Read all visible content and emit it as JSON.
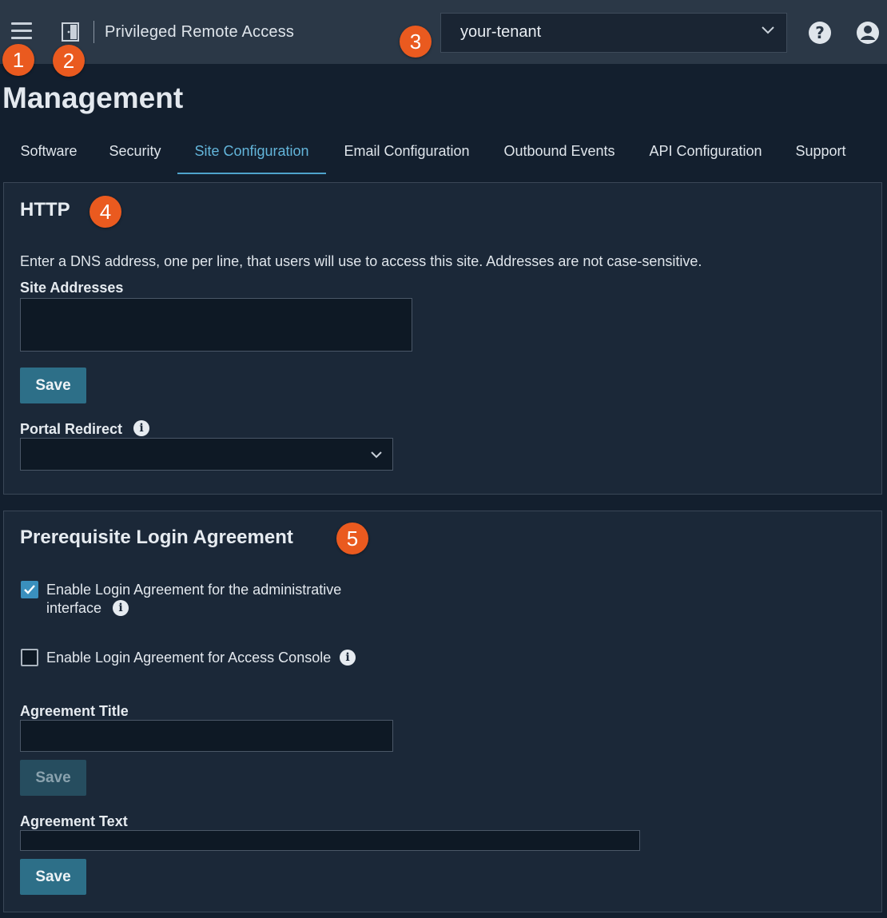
{
  "header": {
    "app_title": "Privileged Remote Access",
    "tenant": "your-tenant",
    "icons": [
      "menu-icon",
      "door-icon",
      "chevron-down-icon",
      "help-icon",
      "user-icon"
    ]
  },
  "callouts": [
    "1",
    "2",
    "3",
    "4",
    "5"
  ],
  "page_title": "Management",
  "tabs": [
    {
      "label": "Software"
    },
    {
      "label": "Security"
    },
    {
      "label": "Site Configuration",
      "active": true
    },
    {
      "label": "Email Configuration"
    },
    {
      "label": "Outbound Events"
    },
    {
      "label": "API Configuration"
    },
    {
      "label": "Support"
    }
  ],
  "http": {
    "title": "HTTP",
    "description": "Enter a DNS address, one per line, that users will use to access this site. Addresses are not case-sensitive.",
    "site_addresses_label": "Site Addresses",
    "site_addresses_value": "",
    "save_label": "Save",
    "portal_redirect_label": "Portal Redirect",
    "portal_redirect_value": ""
  },
  "agreement": {
    "title": "Prerequisite Login Agreement",
    "enable_admin_label_line1": "Enable Login Agreement for the administrative",
    "enable_admin_label_line2": "interface",
    "enable_admin_checked": true,
    "enable_console_label": "Enable Login Agreement for Access Console",
    "enable_console_checked": false,
    "agreement_title_label": "Agreement Title",
    "agreement_title_value": "",
    "save_title_label": "Save",
    "agreement_text_label": "Agreement Text",
    "agreement_text_value": "",
    "save_text_label": "Save"
  },
  "colors": {
    "topbar": "#2b3847",
    "background": "#131f2e",
    "panel": "#1b2838",
    "accent": "#63b5da",
    "button": "#2d6f88",
    "callout": "#ea5a1f"
  }
}
